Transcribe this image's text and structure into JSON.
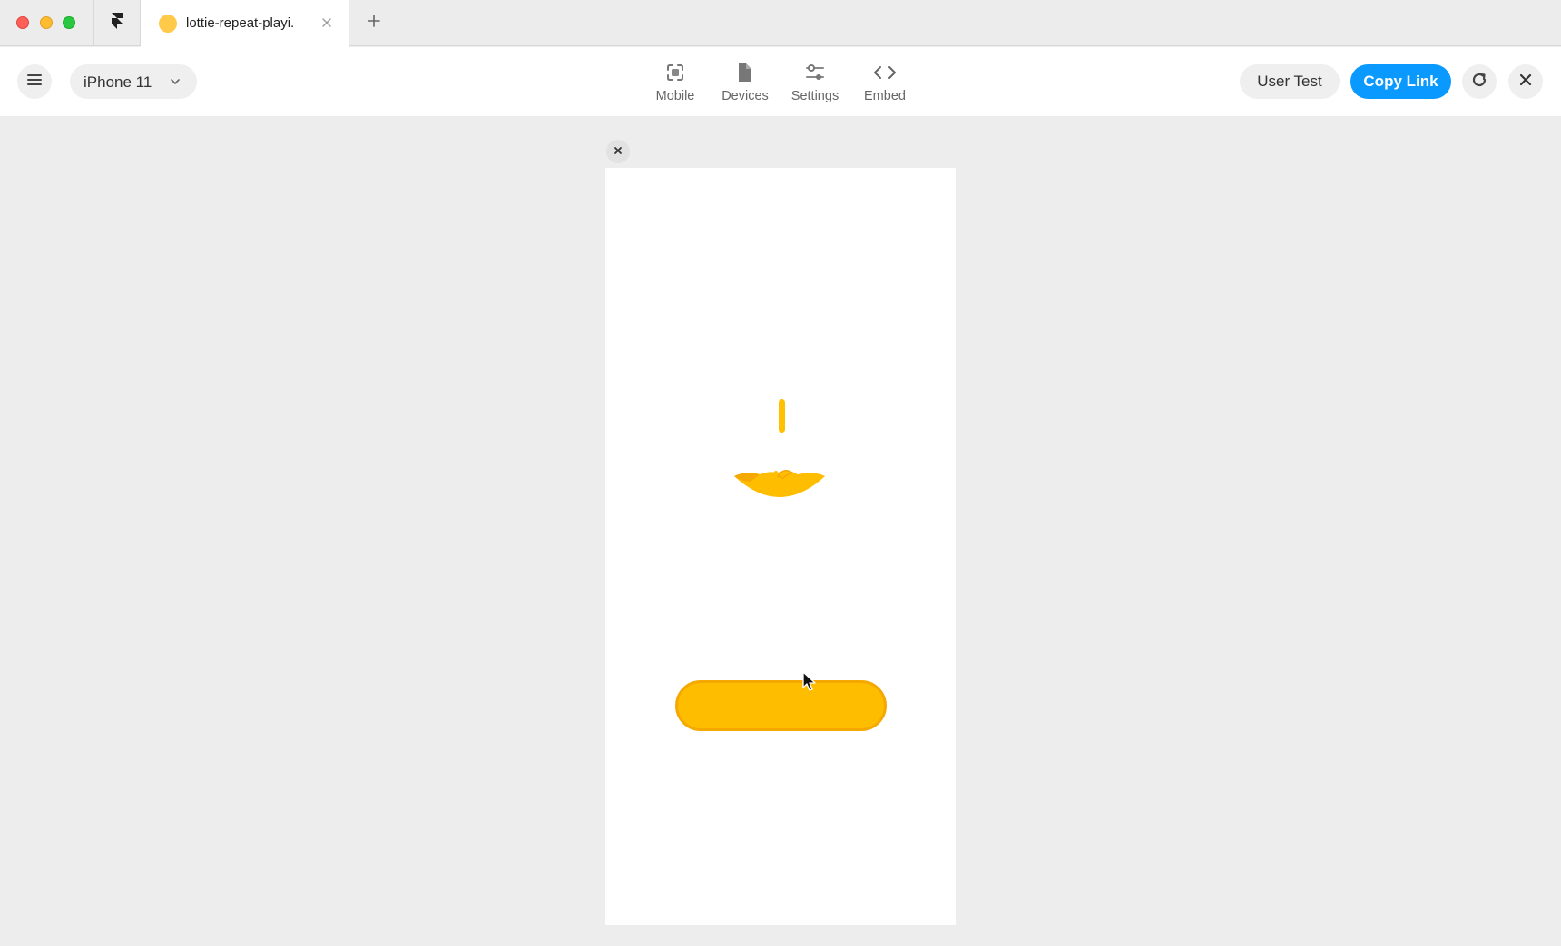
{
  "browser": {
    "tab_title": "lottie-repeat-playi.",
    "colors": {
      "favicon": "#ffc94a"
    }
  },
  "toolbar": {
    "device_select": {
      "selected": "iPhone 11"
    },
    "tools": [
      {
        "label": "Mobile",
        "icon": "mobile-frame-icon"
      },
      {
        "label": "Devices",
        "icon": "devices-icon"
      },
      {
        "label": "Settings",
        "icon": "sliders-icon"
      },
      {
        "label": "Embed",
        "icon": "code-icon"
      }
    ],
    "user_test_label": "User Test",
    "copy_link_label": "Copy Link",
    "colors": {
      "accent": "#0a99ff"
    }
  },
  "preview": {
    "colors": {
      "drop": "#ffc000",
      "bowl": "#ffbd00",
      "button": "#ffbd00",
      "button_border": "#f5a800"
    }
  }
}
